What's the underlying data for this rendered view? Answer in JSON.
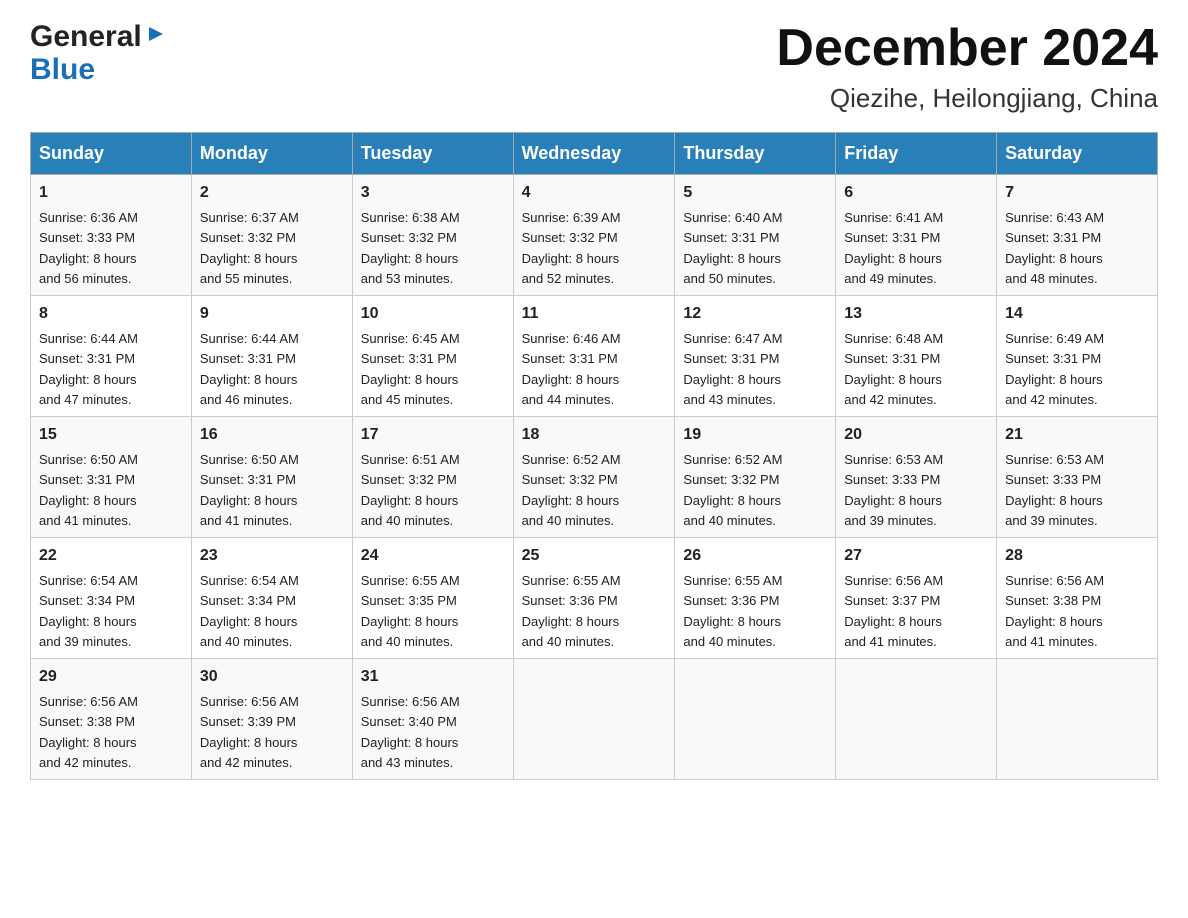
{
  "header": {
    "title": "December 2024",
    "subtitle": "Qiezihe, Heilongjiang, China",
    "logo_general": "General",
    "logo_blue": "Blue"
  },
  "days_of_week": [
    "Sunday",
    "Monday",
    "Tuesday",
    "Wednesday",
    "Thursday",
    "Friday",
    "Saturday"
  ],
  "weeks": [
    [
      {
        "day": "1",
        "sunrise": "6:36 AM",
        "sunset": "3:33 PM",
        "daylight": "8 hours and 56 minutes."
      },
      {
        "day": "2",
        "sunrise": "6:37 AM",
        "sunset": "3:32 PM",
        "daylight": "8 hours and 55 minutes."
      },
      {
        "day": "3",
        "sunrise": "6:38 AM",
        "sunset": "3:32 PM",
        "daylight": "8 hours and 53 minutes."
      },
      {
        "day": "4",
        "sunrise": "6:39 AM",
        "sunset": "3:32 PM",
        "daylight": "8 hours and 52 minutes."
      },
      {
        "day": "5",
        "sunrise": "6:40 AM",
        "sunset": "3:31 PM",
        "daylight": "8 hours and 50 minutes."
      },
      {
        "day": "6",
        "sunrise": "6:41 AM",
        "sunset": "3:31 PM",
        "daylight": "8 hours and 49 minutes."
      },
      {
        "day": "7",
        "sunrise": "6:43 AM",
        "sunset": "3:31 PM",
        "daylight": "8 hours and 48 minutes."
      }
    ],
    [
      {
        "day": "8",
        "sunrise": "6:44 AM",
        "sunset": "3:31 PM",
        "daylight": "8 hours and 47 minutes."
      },
      {
        "day": "9",
        "sunrise": "6:44 AM",
        "sunset": "3:31 PM",
        "daylight": "8 hours and 46 minutes."
      },
      {
        "day": "10",
        "sunrise": "6:45 AM",
        "sunset": "3:31 PM",
        "daylight": "8 hours and 45 minutes."
      },
      {
        "day": "11",
        "sunrise": "6:46 AM",
        "sunset": "3:31 PM",
        "daylight": "8 hours and 44 minutes."
      },
      {
        "day": "12",
        "sunrise": "6:47 AM",
        "sunset": "3:31 PM",
        "daylight": "8 hours and 43 minutes."
      },
      {
        "day": "13",
        "sunrise": "6:48 AM",
        "sunset": "3:31 PM",
        "daylight": "8 hours and 42 minutes."
      },
      {
        "day": "14",
        "sunrise": "6:49 AM",
        "sunset": "3:31 PM",
        "daylight": "8 hours and 42 minutes."
      }
    ],
    [
      {
        "day": "15",
        "sunrise": "6:50 AM",
        "sunset": "3:31 PM",
        "daylight": "8 hours and 41 minutes."
      },
      {
        "day": "16",
        "sunrise": "6:50 AM",
        "sunset": "3:31 PM",
        "daylight": "8 hours and 41 minutes."
      },
      {
        "day": "17",
        "sunrise": "6:51 AM",
        "sunset": "3:32 PM",
        "daylight": "8 hours and 40 minutes."
      },
      {
        "day": "18",
        "sunrise": "6:52 AM",
        "sunset": "3:32 PM",
        "daylight": "8 hours and 40 minutes."
      },
      {
        "day": "19",
        "sunrise": "6:52 AM",
        "sunset": "3:32 PM",
        "daylight": "8 hours and 40 minutes."
      },
      {
        "day": "20",
        "sunrise": "6:53 AM",
        "sunset": "3:33 PM",
        "daylight": "8 hours and 39 minutes."
      },
      {
        "day": "21",
        "sunrise": "6:53 AM",
        "sunset": "3:33 PM",
        "daylight": "8 hours and 39 minutes."
      }
    ],
    [
      {
        "day": "22",
        "sunrise": "6:54 AM",
        "sunset": "3:34 PM",
        "daylight": "8 hours and 39 minutes."
      },
      {
        "day": "23",
        "sunrise": "6:54 AM",
        "sunset": "3:34 PM",
        "daylight": "8 hours and 40 minutes."
      },
      {
        "day": "24",
        "sunrise": "6:55 AM",
        "sunset": "3:35 PM",
        "daylight": "8 hours and 40 minutes."
      },
      {
        "day": "25",
        "sunrise": "6:55 AM",
        "sunset": "3:36 PM",
        "daylight": "8 hours and 40 minutes."
      },
      {
        "day": "26",
        "sunrise": "6:55 AM",
        "sunset": "3:36 PM",
        "daylight": "8 hours and 40 minutes."
      },
      {
        "day": "27",
        "sunrise": "6:56 AM",
        "sunset": "3:37 PM",
        "daylight": "8 hours and 41 minutes."
      },
      {
        "day": "28",
        "sunrise": "6:56 AM",
        "sunset": "3:38 PM",
        "daylight": "8 hours and 41 minutes."
      }
    ],
    [
      {
        "day": "29",
        "sunrise": "6:56 AM",
        "sunset": "3:38 PM",
        "daylight": "8 hours and 42 minutes."
      },
      {
        "day": "30",
        "sunrise": "6:56 AM",
        "sunset": "3:39 PM",
        "daylight": "8 hours and 42 minutes."
      },
      {
        "day": "31",
        "sunrise": "6:56 AM",
        "sunset": "3:40 PM",
        "daylight": "8 hours and 43 minutes."
      },
      {
        "day": "",
        "sunrise": "",
        "sunset": "",
        "daylight": ""
      },
      {
        "day": "",
        "sunrise": "",
        "sunset": "",
        "daylight": ""
      },
      {
        "day": "",
        "sunrise": "",
        "sunset": "",
        "daylight": ""
      },
      {
        "day": "",
        "sunrise": "",
        "sunset": "",
        "daylight": ""
      }
    ]
  ]
}
